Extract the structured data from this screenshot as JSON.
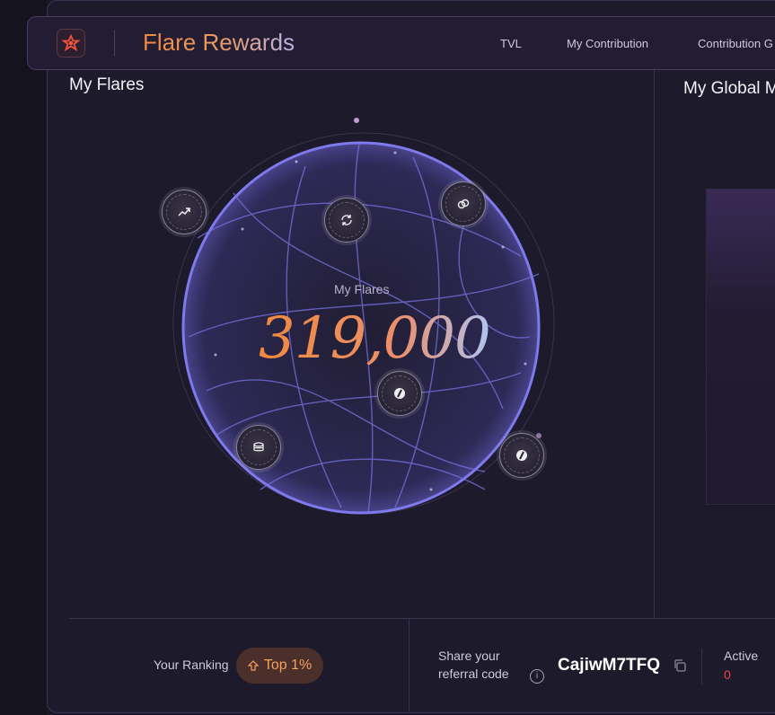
{
  "header": {
    "title": "Flare Rewards",
    "nav": [
      "TVL",
      "My Contribution",
      "Contribution G"
    ]
  },
  "left_panel": {
    "title": "My Flares",
    "metric_label": "My Flares",
    "metric_value": "319,000",
    "orb_icons": [
      "trend-up-icon",
      "refresh-icon",
      "link-icon",
      "slash-token-icon",
      "coins-icon",
      "slash-token-icon"
    ]
  },
  "right_panel": {
    "title": "My Global M"
  },
  "footer": {
    "ranking_label": "Your Ranking",
    "ranking_value": "Top 1%",
    "share_label": "Share your referral code",
    "referral_code": "CajiwM7TFQ",
    "active_label": "Active",
    "active_value": "0"
  },
  "colors": {
    "accent": "#f08a3e",
    "danger": "#f0483c",
    "globe": "#6f6ad8"
  }
}
